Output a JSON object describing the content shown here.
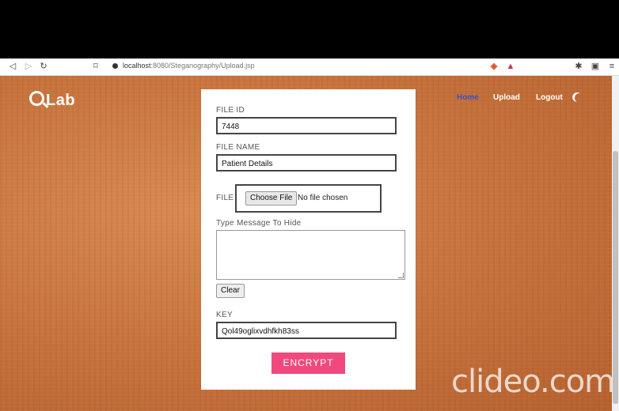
{
  "browser": {
    "url_host": "localhost",
    "url_rest": ":8080/Steganography/Upload.jsp"
  },
  "header": {
    "logo": "Lab",
    "nav": [
      "Home",
      "Upload",
      "Logout"
    ],
    "active_nav": "Home",
    "active_color": "#3552c7"
  },
  "form": {
    "file_id_label": "FILE ID",
    "file_id_value": "7448",
    "file_name_label": "FILE NAME",
    "file_name_value": "Patient Details",
    "file_label": "FILE",
    "choose_file_label": "Choose File",
    "no_file_text": "No file chosen",
    "message_label": "Type Message To Hide",
    "message_value": "",
    "clear_label": "Clear",
    "key_label": "KEY",
    "key_value": "Qol49oglixvdhfkh83ss",
    "submit_label": "ENCRYPT",
    "submit_color": "#f0497e"
  },
  "watermark": "clideo.com"
}
